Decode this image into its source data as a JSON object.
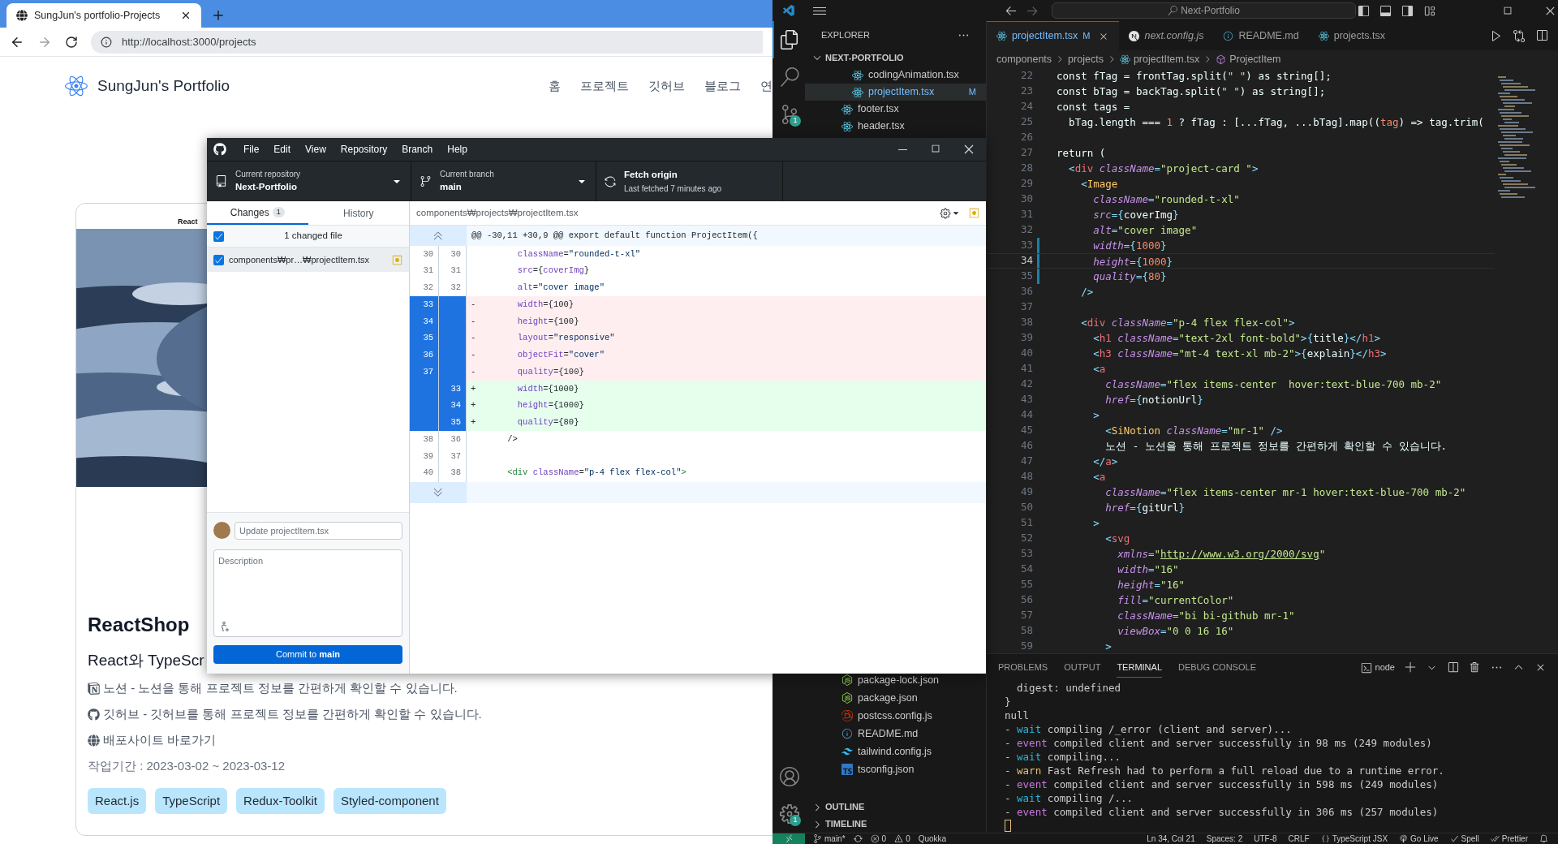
{
  "browser": {
    "tab_title": "SungJun's portfolio-Projects",
    "back_enabled": true,
    "forward_enabled": false,
    "url": "http://localhost:3000/projects",
    "site": {
      "title": "SungJun's Portfolio",
      "nav": [
        "홈",
        "프로젝트",
        "깃허브",
        "블로그",
        "연"
      ]
    },
    "card": {
      "caption": "React",
      "picture": {
        "kind": "picture"
      },
      "title": "ReactShop",
      "subtitle": "React와 TypeScr",
      "links": [
        {
          "kind": "notion",
          "text": "노션 - 노션을 통해 프로젝트 정보를 간편하게 확인할 수 있습니다."
        },
        {
          "kind": "github",
          "text": "깃허브 - 깃허브를 통해 프로젝트 정보를 간편하게 확인할 수 있습니다."
        },
        {
          "kind": "web",
          "text": "배포사이트 바로가기"
        }
      ],
      "period": "작업기간 : 2023-03-02 ~ 2023-03-12",
      "tags": [
        "React.js",
        "TypeScript",
        "Redux-Toolkit",
        "Styled-component"
      ]
    }
  },
  "github_desktop": {
    "menu": [
      "File",
      "Edit",
      "View",
      "Repository",
      "Branch",
      "Help"
    ],
    "repository": {
      "label": "Current repository",
      "value": "Next-Portfolio"
    },
    "branch": {
      "label": "Current branch",
      "value": "main"
    },
    "fetch": {
      "title": "Fetch origin",
      "subtitle": "Last fetched 7 minutes ago"
    },
    "tabs": [
      {
        "label": "Changes",
        "count": "1",
        "selected": true
      },
      {
        "label": "History",
        "selected": false
      }
    ],
    "changed_files_label": "1 changed file",
    "all_checked": true,
    "files": [
      {
        "path": "components₩pr…₩projectItem.tsx",
        "checked": true,
        "selected": true
      }
    ],
    "diff_path": "components₩projects₩projectItem.tsx",
    "hunk_header": "@@ -30,11 +30,9 @@ export default function ProjectItem({",
    "diff_lines": [
      {
        "old": "30",
        "new": "30",
        "kind": "context",
        "selected": false,
        "tokens": [
          {
            "kind": "attr",
            "text": "      className"
          },
          {
            "kind": "punct",
            "text": "="
          },
          {
            "kind": "string",
            "text": "\"rounded-t-xl\""
          }
        ]
      },
      {
        "old": "31",
        "new": "31",
        "kind": "context",
        "selected": false,
        "tokens": [
          {
            "kind": "attr",
            "text": "      src"
          },
          {
            "kind": "punct",
            "text": "={"
          },
          {
            "kind": "attr",
            "text": "coverImg"
          },
          {
            "kind": "punct",
            "text": "}"
          }
        ]
      },
      {
        "old": "32",
        "new": "32",
        "kind": "context",
        "selected": false,
        "tokens": [
          {
            "kind": "attr",
            "text": "      alt"
          },
          {
            "kind": "punct",
            "text": "="
          },
          {
            "kind": "string",
            "text": "\"cover image\""
          }
        ]
      },
      {
        "old": "33",
        "kind": "removed",
        "marker": "-",
        "selected": true,
        "tokens": [
          {
            "kind": "attr",
            "text": "      width"
          },
          {
            "kind": "punct",
            "text": "={100}"
          }
        ]
      },
      {
        "old": "34",
        "kind": "removed",
        "marker": "-",
        "selected": true,
        "tokens": [
          {
            "kind": "attr",
            "text": "      height"
          },
          {
            "kind": "punct",
            "text": "={100}"
          }
        ]
      },
      {
        "old": "35",
        "kind": "removed",
        "marker": "-",
        "selected": true,
        "tokens": [
          {
            "kind": "attr",
            "text": "      layout"
          },
          {
            "kind": "punct",
            "text": "="
          },
          {
            "kind": "string",
            "text": "\"responsive\""
          }
        ]
      },
      {
        "old": "36",
        "kind": "removed",
        "marker": "-",
        "selected": true,
        "tokens": [
          {
            "kind": "attr",
            "text": "      objectFit"
          },
          {
            "kind": "punct",
            "text": "="
          },
          {
            "kind": "string",
            "text": "\"cover\""
          }
        ]
      },
      {
        "old": "37",
        "kind": "removed",
        "marker": "-",
        "selected": true,
        "tokens": [
          {
            "kind": "attr",
            "text": "      quality"
          },
          {
            "kind": "punct",
            "text": "={100}"
          }
        ]
      },
      {
        "new": "33",
        "kind": "added",
        "marker": "+",
        "selected": true,
        "tokens": [
          {
            "kind": "attr",
            "text": "      width"
          },
          {
            "kind": "punct",
            "text": "={1000}"
          }
        ]
      },
      {
        "new": "34",
        "kind": "added",
        "marker": "+",
        "selected": true,
        "tokens": [
          {
            "kind": "attr",
            "text": "      height"
          },
          {
            "kind": "punct",
            "text": "={1000}"
          }
        ]
      },
      {
        "new": "35",
        "kind": "added",
        "marker": "+",
        "selected": true,
        "tokens": [
          {
            "kind": "attr",
            "text": "      quality"
          },
          {
            "kind": "punct",
            "text": "={80}"
          }
        ]
      },
      {
        "old": "38",
        "new": "36",
        "kind": "context",
        "selected": false,
        "tokens": [
          {
            "kind": "punct",
            "text": "    />"
          }
        ]
      },
      {
        "old": "39",
        "new": "37",
        "kind": "context",
        "selected": false
      },
      {
        "old": "40",
        "new": "38",
        "kind": "context",
        "selected": false,
        "tokens": [
          {
            "kind": "tag",
            "text": "    <div"
          },
          {
            "kind": "attr",
            "text": " className"
          },
          {
            "kind": "punct",
            "text": "="
          },
          {
            "kind": "string",
            "text": "\"p-4 flex flex-col\""
          },
          {
            "kind": "tag",
            "text": ">"
          }
        ]
      }
    ],
    "summary_placeholder": "Update projectItem.tsx",
    "description_placeholder": "Description",
    "commit_button": "Commit to **main**"
  },
  "vscode": {
    "search": "Next-Portfolio",
    "activity_top": [
      {
        "kind": "files",
        "selected": true
      },
      {
        "kind": "search",
        "selected": false
      },
      {
        "kind": "scm",
        "selected": false,
        "badge": "1"
      }
    ],
    "activity_bottom": [
      {
        "kind": "account"
      },
      {
        "kind": "settings",
        "badge": "1"
      }
    ],
    "explorer": {
      "title": "EXPLORER",
      "root": {
        "label": "NEXT-PORTFOLIO",
        "expanded": true
      },
      "tree": [
        {
          "children": [
            {
              "label": "codingAnimation.tsx",
              "kind": "react",
              "selected": false
            },
            {
              "label": "projectItem.tsx",
              "kind": "react",
              "badge": "M",
              "selected": true
            }
          ]
        },
        {
          "label": "footer.tsx",
          "kind": "react",
          "selected": false
        },
        {
          "label": "header.tsx",
          "kind": "react",
          "selected": false
        }
      ],
      "lower_files": [
        {
          "label": "package-lock.json",
          "kind": "node"
        },
        {
          "label": "package.json",
          "kind": "node"
        },
        {
          "label": "postcss.config.js",
          "kind": "postcss"
        },
        {
          "label": "README.md",
          "kind": "info"
        },
        {
          "label": "tailwind.config.js",
          "kind": "tailwind"
        },
        {
          "label": "tsconfig.json",
          "kind": "typescript"
        }
      ],
      "sections": [
        {
          "label": "OUTLINE",
          "expanded": false
        },
        {
          "label": "TIMELINE",
          "expanded": false
        }
      ]
    },
    "tabs": [
      {
        "label": "projectItem.tsx",
        "kind": "react",
        "badge": "M",
        "selected": true,
        "preview": false
      },
      {
        "label": "next.config.js",
        "kind": "next",
        "selected": false,
        "preview": true
      },
      {
        "label": "README.md",
        "kind": "info",
        "selected": false,
        "preview": false
      },
      {
        "label": "projects.tsx",
        "kind": "react",
        "selected": false,
        "preview": false
      }
    ],
    "breadcrumb": [
      {
        "kind": "folder",
        "label": "components"
      },
      {
        "kind": "folder",
        "label": "projects"
      },
      {
        "kind": "react",
        "label": "projectItem.tsx"
      },
      {
        "kind": "symbol",
        "label": "ProjectItem"
      }
    ],
    "code_lines": [
      {
        "number": "22",
        "kind": "normal",
        "tokens": [
          {
            "kind": "plain",
            "text": "  const fTag = frontTag.split("
          },
          {
            "kind": "string",
            "text": "\" \""
          },
          {
            "kind": "plain",
            "text": ") as string[];"
          }
        ]
      },
      {
        "number": "23",
        "kind": "normal",
        "tokens": [
          {
            "kind": "plain",
            "text": "  const bTag = backTag.split("
          },
          {
            "kind": "string",
            "text": "\" \""
          },
          {
            "kind": "plain",
            "text": ") as string[];"
          }
        ]
      },
      {
        "number": "24",
        "kind": "normal",
        "tokens": [
          {
            "kind": "plain",
            "text": "  const tags ="
          }
        ]
      },
      {
        "number": "25",
        "kind": "normal",
        "tokens": [
          {
            "kind": "plain",
            "text": "    bTag.length === "
          },
          {
            "kind": "number",
            "text": "1"
          },
          {
            "kind": "plain",
            "text": " ? fTag : [...fTag, ...bTag].map(("
          },
          {
            "kind": "param",
            "text": "tag"
          },
          {
            "kind": "plain",
            "text": ") => tag.trim("
          }
        ]
      },
      {
        "number": "26",
        "kind": "normal"
      },
      {
        "number": "27",
        "kind": "normal",
        "tokens": [
          {
            "kind": "plain",
            "text": "  return ("
          }
        ]
      },
      {
        "number": "28",
        "kind": "normal",
        "tokens": [
          {
            "kind": "punct",
            "text": "    <"
          },
          {
            "kind": "tag",
            "text": "div"
          },
          {
            "kind": "attr",
            "text": " className"
          },
          {
            "kind": "punct",
            "text": "="
          },
          {
            "kind": "string",
            "text": "\"project-card \""
          },
          {
            "kind": "punct",
            "text": ">"
          }
        ]
      },
      {
        "number": "29",
        "kind": "normal",
        "tokens": [
          {
            "kind": "punct",
            "text": "      <"
          },
          {
            "kind": "component",
            "text": "Image"
          }
        ]
      },
      {
        "number": "30",
        "kind": "normal",
        "tokens": [
          {
            "kind": "attr",
            "text": "        className"
          },
          {
            "kind": "punct",
            "text": "="
          },
          {
            "kind": "string",
            "text": "\"rounded-t-xl\""
          }
        ]
      },
      {
        "number": "31",
        "kind": "normal",
        "tokens": [
          {
            "kind": "attr",
            "text": "        src"
          },
          {
            "kind": "punct",
            "text": "={"
          },
          {
            "kind": "plain",
            "text": "coverImg"
          },
          {
            "kind": "punct",
            "text": "}"
          }
        ]
      },
      {
        "number": "32",
        "kind": "normal",
        "tokens": [
          {
            "kind": "attr",
            "text": "        alt"
          },
          {
            "kind": "punct",
            "text": "="
          },
          {
            "kind": "string",
            "text": "\"cover image\""
          }
        ]
      },
      {
        "number": "33",
        "kind": "modified",
        "tokens": [
          {
            "kind": "attr",
            "text": "        width"
          },
          {
            "kind": "punct",
            "text": "={"
          },
          {
            "kind": "number",
            "text": "1000"
          },
          {
            "kind": "punct",
            "text": "}"
          }
        ]
      },
      {
        "number": "34",
        "kind": "modified_current",
        "tokens": [
          {
            "kind": "attr",
            "text": "        height"
          },
          {
            "kind": "punct",
            "text": "={"
          },
          {
            "kind": "number",
            "text": "1000"
          },
          {
            "kind": "punct",
            "text": "}"
          }
        ]
      },
      {
        "number": "35",
        "kind": "modified",
        "tokens": [
          {
            "kind": "attr",
            "text": "        quality"
          },
          {
            "kind": "punct",
            "text": "={"
          },
          {
            "kind": "number",
            "text": "80"
          },
          {
            "kind": "punct",
            "text": "}"
          }
        ]
      },
      {
        "number": "36",
        "kind": "normal",
        "tokens": [
          {
            "kind": "punct",
            "text": "      />"
          }
        ]
      },
      {
        "number": "37",
        "kind": "normal"
      },
      {
        "number": "38",
        "kind": "normal",
        "tokens": [
          {
            "kind": "punct",
            "text": "      <"
          },
          {
            "kind": "tag",
            "text": "div"
          },
          {
            "kind": "attr",
            "text": " className"
          },
          {
            "kind": "punct",
            "text": "="
          },
          {
            "kind": "string",
            "text": "\"p-4 flex flex-col\""
          },
          {
            "kind": "punct",
            "text": ">"
          }
        ]
      },
      {
        "number": "39",
        "kind": "normal",
        "tokens": [
          {
            "kind": "punct",
            "text": "        <"
          },
          {
            "kind": "tag",
            "text": "h1"
          },
          {
            "kind": "attr",
            "text": " className"
          },
          {
            "kind": "punct",
            "text": "="
          },
          {
            "kind": "string",
            "text": "\"text-2xl font-bold\""
          },
          {
            "kind": "punct",
            "text": ">{"
          },
          {
            "kind": "plain",
            "text": "title"
          },
          {
            "kind": "punct",
            "text": "}</"
          },
          {
            "kind": "tag",
            "text": "h1"
          },
          {
            "kind": "punct",
            "text": ">"
          }
        ]
      },
      {
        "number": "40",
        "kind": "normal",
        "tokens": [
          {
            "kind": "punct",
            "text": "        <"
          },
          {
            "kind": "tag",
            "text": "h3"
          },
          {
            "kind": "attr",
            "text": " className"
          },
          {
            "kind": "punct",
            "text": "="
          },
          {
            "kind": "string",
            "text": "\"mt-4 text-xl mb-2\""
          },
          {
            "kind": "punct",
            "text": ">{"
          },
          {
            "kind": "plain",
            "text": "explain"
          },
          {
            "kind": "punct",
            "text": "}</"
          },
          {
            "kind": "tag",
            "text": "h3"
          },
          {
            "kind": "punct",
            "text": ">"
          }
        ]
      },
      {
        "number": "41",
        "kind": "normal",
        "tokens": [
          {
            "kind": "punct",
            "text": "        <"
          },
          {
            "kind": "tag",
            "text": "a"
          }
        ]
      },
      {
        "number": "42",
        "kind": "normal",
        "tokens": [
          {
            "kind": "attr",
            "text": "          className"
          },
          {
            "kind": "punct",
            "text": "="
          },
          {
            "kind": "string",
            "text": "\"flex items-center  hover:text-blue-700 mb-2\""
          }
        ]
      },
      {
        "number": "43",
        "kind": "normal",
        "tokens": [
          {
            "kind": "attr",
            "text": "          href"
          },
          {
            "kind": "punct",
            "text": "={"
          },
          {
            "kind": "plain",
            "text": "notionUrl"
          },
          {
            "kind": "punct",
            "text": "}"
          }
        ]
      },
      {
        "number": "44",
        "kind": "normal",
        "tokens": [
          {
            "kind": "punct",
            "text": "        >"
          }
        ]
      },
      {
        "number": "45",
        "kind": "normal",
        "tokens": [
          {
            "kind": "punct",
            "text": "          <"
          },
          {
            "kind": "component",
            "text": "SiNotion"
          },
          {
            "kind": "attr",
            "text": " className"
          },
          {
            "kind": "punct",
            "text": "="
          },
          {
            "kind": "string",
            "text": "\"mr-1\""
          },
          {
            "kind": "punct",
            "text": " />"
          }
        ]
      },
      {
        "number": "46",
        "kind": "normal",
        "tokens": [
          {
            "kind": "plain",
            "text": "          노션 - 노션을 통해 프로젝트 정보를 간편하게 확인할 수 있습니다."
          }
        ]
      },
      {
        "number": "47",
        "kind": "normal",
        "tokens": [
          {
            "kind": "punct",
            "text": "        </"
          },
          {
            "kind": "tag",
            "text": "a"
          },
          {
            "kind": "punct",
            "text": ">"
          }
        ]
      },
      {
        "number": "48",
        "kind": "normal",
        "tokens": [
          {
            "kind": "punct",
            "text": "        <"
          },
          {
            "kind": "tag",
            "text": "a"
          }
        ]
      },
      {
        "number": "49",
        "kind": "normal",
        "tokens": [
          {
            "kind": "attr",
            "text": "          className"
          },
          {
            "kind": "punct",
            "text": "="
          },
          {
            "kind": "string",
            "text": "\"flex items-center mr-1 hover:text-blue-700 mb-2\""
          }
        ]
      },
      {
        "number": "50",
        "kind": "normal",
        "tokens": [
          {
            "kind": "attr",
            "text": "          href"
          },
          {
            "kind": "punct",
            "text": "={"
          },
          {
            "kind": "plain",
            "text": "gitUrl"
          },
          {
            "kind": "punct",
            "text": "}"
          }
        ]
      },
      {
        "number": "51",
        "kind": "normal",
        "tokens": [
          {
            "kind": "punct",
            "text": "        >"
          }
        ]
      },
      {
        "number": "52",
        "kind": "normal",
        "tokens": [
          {
            "kind": "punct",
            "text": "          <"
          },
          {
            "kind": "tag",
            "text": "svg"
          }
        ]
      },
      {
        "number": "53",
        "kind": "normal",
        "tokens": [
          {
            "kind": "attr",
            "text": "            xmlns"
          },
          {
            "kind": "punct",
            "text": "="
          },
          {
            "kind": "string",
            "text": "\""
          },
          {
            "kind": "link",
            "text": "http://www.w3.org/2000/svg"
          },
          {
            "kind": "string",
            "text": "\""
          }
        ]
      },
      {
        "number": "54",
        "kind": "normal",
        "tokens": [
          {
            "kind": "attr",
            "text": "            width"
          },
          {
            "kind": "punct",
            "text": "="
          },
          {
            "kind": "string",
            "text": "\"16\""
          }
        ]
      },
      {
        "number": "55",
        "kind": "normal",
        "tokens": [
          {
            "kind": "attr",
            "text": "            height"
          },
          {
            "kind": "punct",
            "text": "="
          },
          {
            "kind": "string",
            "text": "\"16\""
          }
        ]
      },
      {
        "number": "56",
        "kind": "normal",
        "tokens": [
          {
            "kind": "attr",
            "text": "            fill"
          },
          {
            "kind": "punct",
            "text": "="
          },
          {
            "kind": "string",
            "text": "\"currentColor\""
          }
        ]
      },
      {
        "number": "57",
        "kind": "normal",
        "tokens": [
          {
            "kind": "attr",
            "text": "            className"
          },
          {
            "kind": "punct",
            "text": "="
          },
          {
            "kind": "string",
            "text": "\"bi bi-github mr-1\""
          }
        ]
      },
      {
        "number": "58",
        "kind": "normal",
        "tokens": [
          {
            "kind": "attr",
            "text": "            viewBox"
          },
          {
            "kind": "punct",
            "text": "="
          },
          {
            "kind": "string",
            "text": "\"0 0 16 16\""
          }
        ]
      },
      {
        "number": "59",
        "kind": "normal",
        "tokens": [
          {
            "kind": "punct",
            "text": "          >"
          }
        ]
      }
    ],
    "panel_tabs": [
      {
        "label": "PROBLEMS",
        "selected": false
      },
      {
        "label": "OUTPUT",
        "selected": false
      },
      {
        "label": "TERMINAL",
        "selected": true
      },
      {
        "label": "DEBUG CONSOLE",
        "selected": false
      }
    ],
    "terminal_name": "node",
    "terminal_lines": [
      {
        "tokens": [
          {
            "kind": "plain",
            "text": "  digest: undefined"
          }
        ]
      },
      {
        "tokens": [
          {
            "kind": "plain",
            "text": "}"
          }
        ]
      },
      {
        "tokens": [
          {
            "kind": "plain",
            "text": "null"
          }
        ]
      },
      {
        "tokens": [
          {
            "kind": "plain",
            "text": "- "
          },
          {
            "kind": "wait",
            "text": "wait"
          },
          {
            "kind": "plain",
            "text": " compiling /_error (client and server)..."
          }
        ]
      },
      {
        "tokens": [
          {
            "kind": "plain",
            "text": "- "
          },
          {
            "kind": "event",
            "text": "event"
          },
          {
            "kind": "plain",
            "text": " compiled client and server successfully in 98 ms (249 modules)"
          }
        ]
      },
      {
        "tokens": [
          {
            "kind": "plain",
            "text": "- "
          },
          {
            "kind": "wait",
            "text": "wait"
          },
          {
            "kind": "plain",
            "text": " compiling..."
          }
        ]
      },
      {
        "tokens": [
          {
            "kind": "plain",
            "text": "- "
          },
          {
            "kind": "warn",
            "text": "warn"
          },
          {
            "kind": "plain",
            "text": " Fast Refresh had to perform a full reload due to a runtime error."
          }
        ]
      },
      {
        "tokens": [
          {
            "kind": "plain",
            "text": "- "
          },
          {
            "kind": "event",
            "text": "event"
          },
          {
            "kind": "plain",
            "text": " compiled client and server successfully in 598 ms (249 modules)"
          }
        ]
      },
      {
        "tokens": [
          {
            "kind": "plain",
            "text": "- "
          },
          {
            "kind": "wait",
            "text": "wait"
          },
          {
            "kind": "plain",
            "text": " compiling /..."
          }
        ]
      },
      {
        "tokens": [
          {
            "kind": "plain",
            "text": "- "
          },
          {
            "kind": "event",
            "text": "event"
          },
          {
            "kind": "plain",
            "text": " compiled client and server successfully in 306 ms (257 modules)"
          }
        ]
      }
    ],
    "status_left": [
      {
        "kind": "branch",
        "text": "main*"
      },
      {
        "kind": "sync"
      },
      {
        "kind": "errors",
        "text": "0"
      },
      {
        "kind": "warnings",
        "text": "0"
      },
      {
        "kind": "plain",
        "text": "Quokka"
      }
    ],
    "status_right": [
      {
        "kind": "plain",
        "text": "Ln 34, Col 21"
      },
      {
        "kind": "plain",
        "text": "Spaces: 2"
      },
      {
        "kind": "plain",
        "text": "UTF-8"
      },
      {
        "kind": "plain",
        "text": "CRLF"
      },
      {
        "kind": "language",
        "text": "TypeScript JSX"
      },
      {
        "kind": "live",
        "text": "Go Live"
      },
      {
        "kind": "check",
        "text": "Spell"
      },
      {
        "kind": "checkall",
        "text": "Prettier"
      },
      {
        "kind": "bell"
      }
    ]
  }
}
